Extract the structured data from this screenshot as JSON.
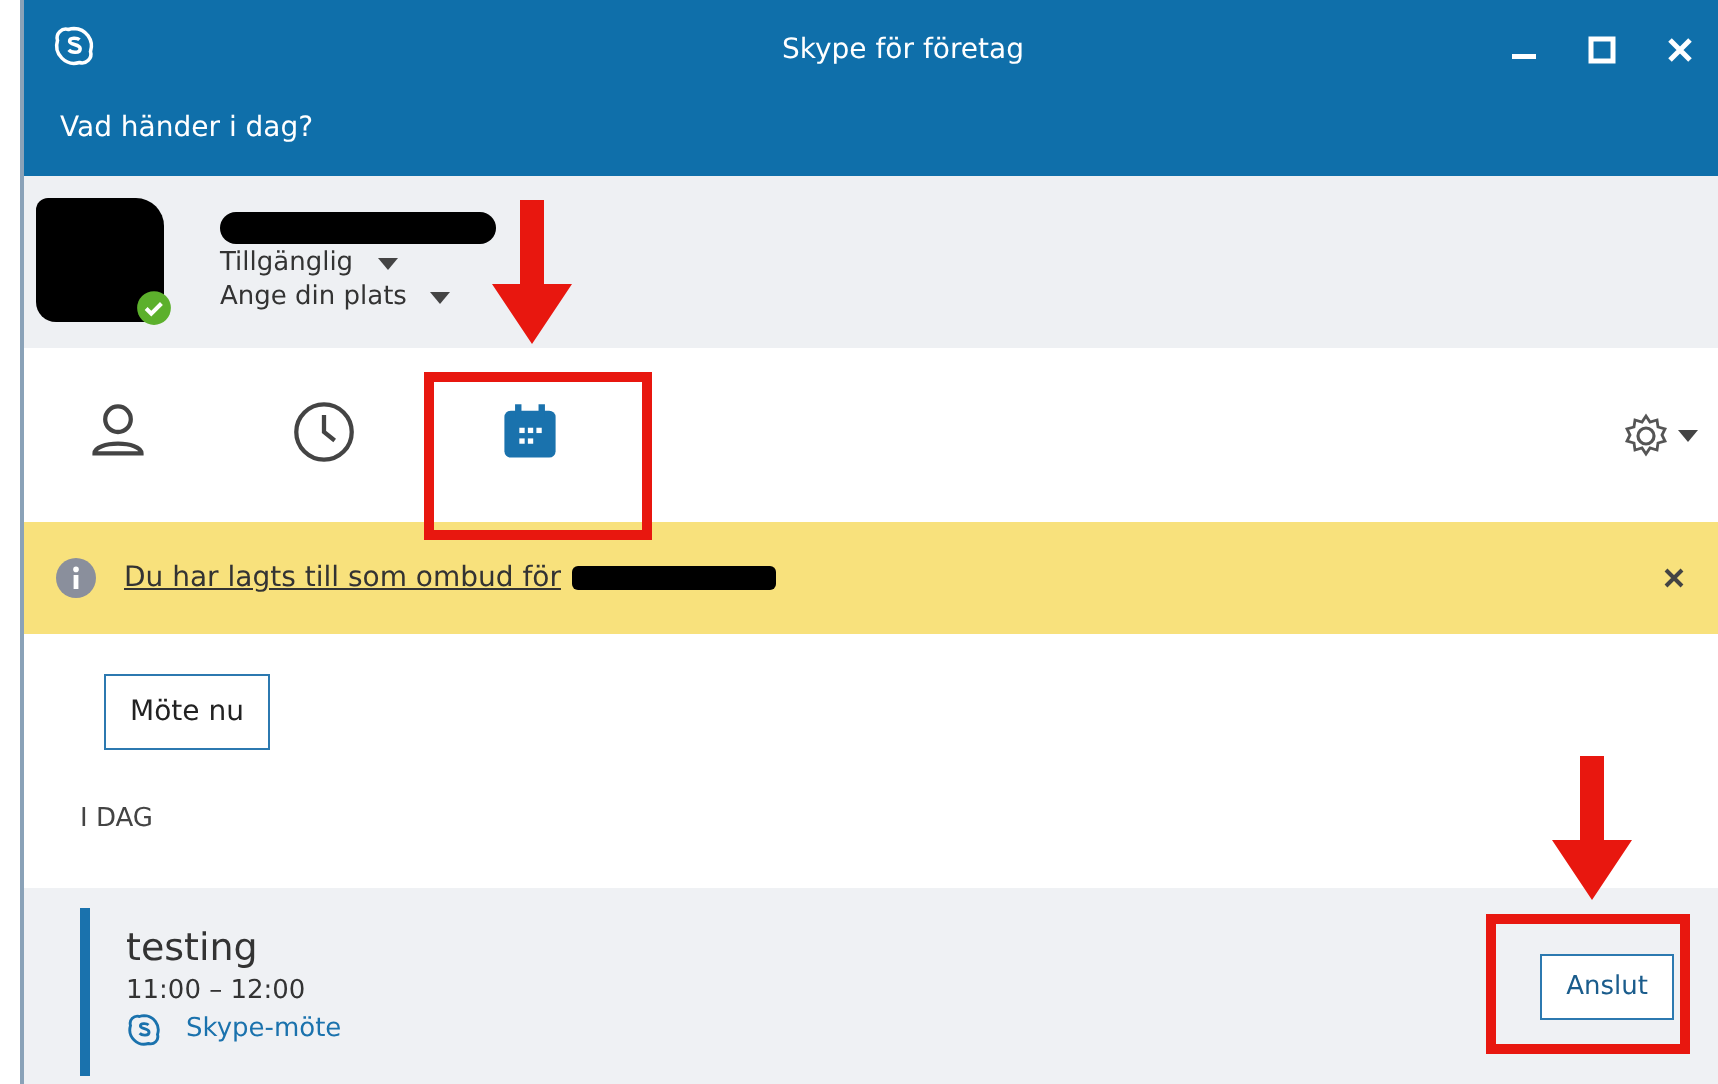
{
  "window": {
    "title": "Skype för företag"
  },
  "status_prompt": "Vad händer i dag?",
  "profile": {
    "availability": "Tillgänglig",
    "location": "Ange din plats"
  },
  "tabs": [
    {
      "kind": "contacts",
      "selected": false
    },
    {
      "kind": "recent",
      "selected": false
    },
    {
      "kind": "meetings",
      "selected": true
    }
  ],
  "banner": {
    "text": "Du har lagts till som ombud för"
  },
  "meet_now_button": "Möte nu",
  "section_label": "I DAG",
  "meetings": [
    {
      "title": "testing",
      "time": "11:00 – 12:00",
      "type": "Skype-möte",
      "join_button": "Anslut"
    }
  ]
}
